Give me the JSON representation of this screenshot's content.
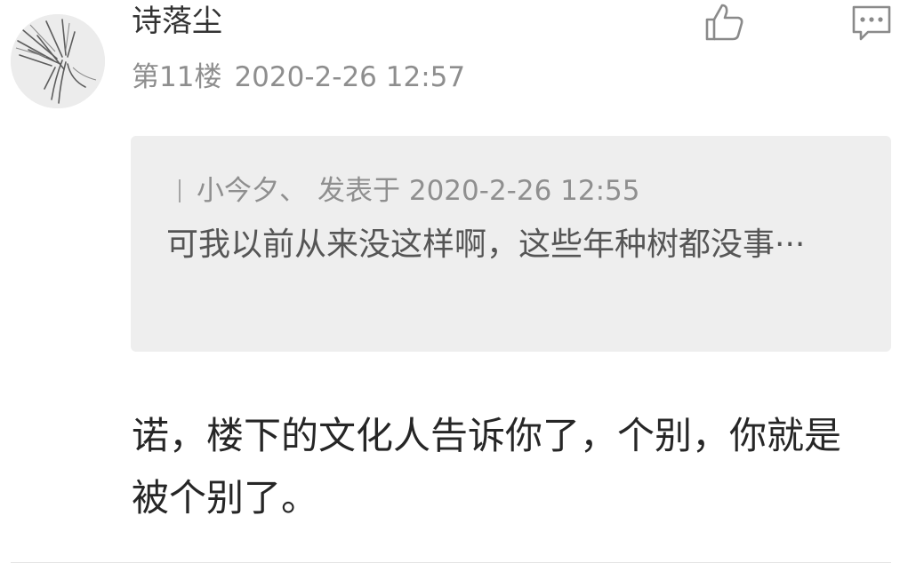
{
  "post": {
    "username": "诗落尘",
    "floor": "第11楼",
    "datetime": "2020-2-26 12:57",
    "quote": {
      "author": "小今夕、",
      "posted_label": "发表于",
      "datetime": "2020-2-26 12:55",
      "text": "可我以前从来没这样啊，这些年种树都没事···"
    },
    "content": "诺，楼下的文化人告诉你了，个别，你就是被个别了。"
  },
  "icons": {
    "like": "thumbs-up-icon",
    "comment": "comment-icon"
  },
  "colors": {
    "quote_background": "#eeeeee",
    "meta_text": "#8e8e8e",
    "icon_stroke": "#8a8a8a"
  }
}
